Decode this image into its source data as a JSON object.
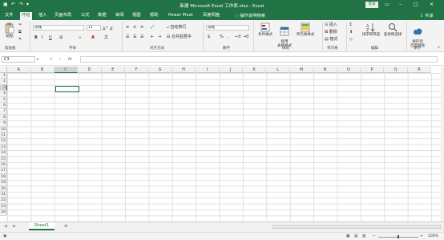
{
  "title_bar": {
    "title": "新建 Microsoft Excel 工作表.xlsx  -  Excel",
    "login": "登录"
  },
  "tabs": [
    "文件",
    "开始",
    "插入",
    "页面布局",
    "公式",
    "数据",
    "审阅",
    "视图",
    "帮助",
    "Power Pivot",
    "百度网盘"
  ],
  "tell_me": "操作说明搜索",
  "share": "共享",
  "ribbon": {
    "clipboard": {
      "paste": "粘贴",
      "label": "剪贴板"
    },
    "font": {
      "name": "等线",
      "size": "11",
      "label": "字体"
    },
    "alignment": {
      "wrap": "自动换行",
      "merge": "合并后居中",
      "label": "对齐方式"
    },
    "number": {
      "format": "常规",
      "label": "数字"
    },
    "styles": {
      "conditional": "条件格式",
      "table": "套用\n表格格式",
      "cell": "单元格样式",
      "label": "样式"
    },
    "cells": {
      "insert": "插入",
      "delete": "删除",
      "format": "格式",
      "label": "单元格"
    },
    "editing": {
      "sort": "排序和筛选",
      "find": "查找和选择",
      "label": "编辑"
    },
    "save": {
      "button": "保存到\n百度网盘",
      "label": "保存"
    }
  },
  "formula_bar": {
    "name_box": "C3",
    "fx": "fx",
    "value": ""
  },
  "columns": [
    "A",
    "B",
    "C",
    "D",
    "E",
    "F",
    "G",
    "H",
    "I",
    "J",
    "K",
    "L",
    "M",
    "N",
    "O",
    "P",
    "Q",
    "R"
  ],
  "rows": [
    "1",
    "2",
    "3",
    "4",
    "5",
    "6",
    "7",
    "8",
    "9",
    "10",
    "11",
    "12",
    "13",
    "14",
    "15",
    "16",
    "17",
    "18",
    "19",
    "20",
    "21",
    "22",
    "23",
    "24"
  ],
  "selected_cell": {
    "column": "C",
    "row": "3"
  },
  "sheets": [
    "Sheet1"
  ],
  "status": {
    "zoom": "100%"
  },
  "colors": {
    "brand": "#217346",
    "ribbon_bg": "#f3f3f3"
  }
}
